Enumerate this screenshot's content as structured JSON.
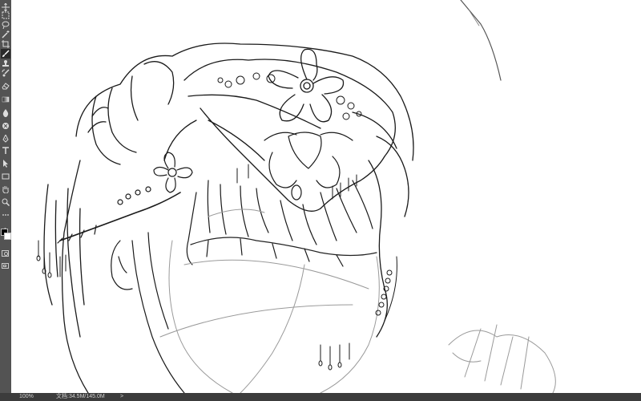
{
  "app": {
    "name": "Photoshop canvas - line art sketch"
  },
  "toolbar": {
    "tools": [
      {
        "name": "move-tool",
        "icon": "move-icon"
      },
      {
        "name": "marquee-tool",
        "icon": "marquee-icon"
      },
      {
        "name": "lasso-tool",
        "icon": "lasso-icon"
      },
      {
        "name": "quick-select-tool",
        "icon": "wand-icon"
      },
      {
        "name": "crop-tool",
        "icon": "crop-icon"
      },
      {
        "name": "eyedropper-tool",
        "icon": "eyedropper-icon"
      },
      {
        "name": "brush-tool",
        "icon": "brush-icon",
        "active": true
      },
      {
        "name": "stamp-tool",
        "icon": "stamp-icon"
      },
      {
        "name": "history-brush-tool",
        "icon": "history-brush-icon"
      },
      {
        "name": "eraser-tool",
        "icon": "eraser-icon"
      },
      {
        "name": "gradient-tool",
        "icon": "gradient-icon"
      },
      {
        "name": "blur-tool",
        "icon": "blur-drop-icon"
      },
      {
        "name": "dodge-tool",
        "icon": "dodge-icon"
      },
      {
        "name": "pen-tool",
        "icon": "pen-icon"
      },
      {
        "name": "type-tool",
        "icon": "type-icon"
      },
      {
        "name": "path-select-tool",
        "icon": "arrow-icon"
      },
      {
        "name": "shape-tool",
        "icon": "rectangle-icon"
      },
      {
        "name": "hand-tool",
        "icon": "hand-icon"
      },
      {
        "name": "zoom-tool",
        "icon": "zoom-icon"
      },
      {
        "name": "more-tools",
        "icon": "ellipsis-icon"
      }
    ],
    "foreground_color": "#000000",
    "background_color": "#ffffff"
  },
  "status": {
    "zoom": "100%",
    "doc_info": "文档:34.5M/145.0M",
    "arrow": ">"
  },
  "colors": {
    "toolbar_bg": "#535353",
    "status_bg": "#3c3c3c",
    "line_art": "#1a1a1a",
    "sketch": "#9a9a9a"
  }
}
